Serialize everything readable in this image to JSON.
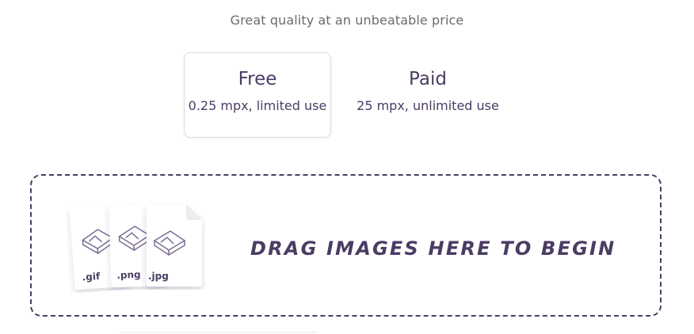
{
  "header": {
    "tagline": "Great quality at an unbeatable price"
  },
  "plans": [
    {
      "name": "Free",
      "description": "0.25 mpx, limited use",
      "selected": true
    },
    {
      "name": "Paid",
      "description": "25 mpx, unlimited use",
      "selected": false
    }
  ],
  "dropzone": {
    "label": "DRAG IMAGES HERE TO BEGIN",
    "file_types": [
      ".gif",
      ".png",
      ".jpg"
    ],
    "icon": "image-file-icon"
  },
  "colors": {
    "accent": "#4a3c63",
    "tagline": "#6b6b6b",
    "card_border": "#dcdcdc"
  }
}
